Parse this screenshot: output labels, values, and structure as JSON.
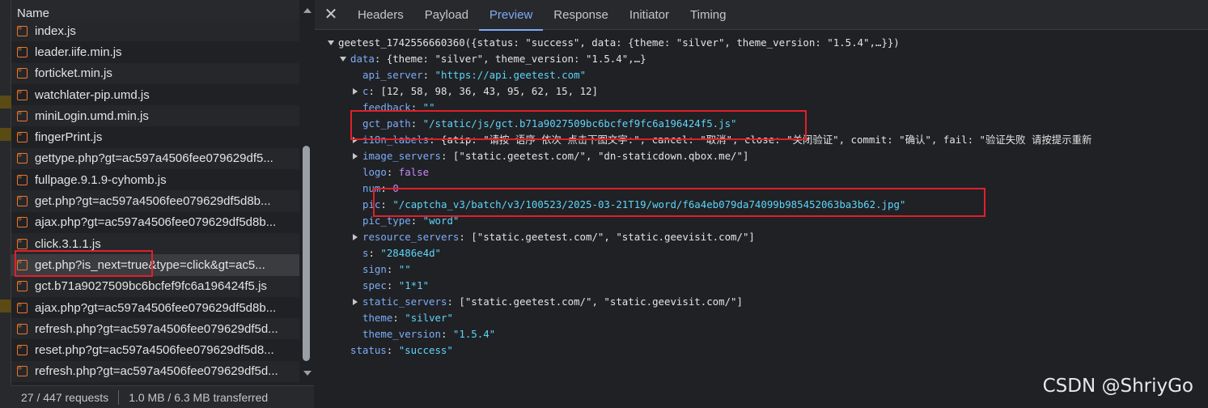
{
  "request_list": {
    "header": "Name",
    "items": [
      {
        "label": "index.js"
      },
      {
        "label": "leader.iife.min.js"
      },
      {
        "label": "forticket.min.js"
      },
      {
        "label": "watchlater-pip.umd.js"
      },
      {
        "label": "miniLogin.umd.min.js"
      },
      {
        "label": "fingerPrint.js"
      },
      {
        "label": "gettype.php?gt=ac597a4506fee079629df5..."
      },
      {
        "label": "fullpage.9.1.9-cyhomb.js"
      },
      {
        "label": "get.php?gt=ac597a4506fee079629df5d8b..."
      },
      {
        "label": "ajax.php?gt=ac597a4506fee079629df5d8b..."
      },
      {
        "label": "click.3.1.1.js"
      },
      {
        "label": "get.php?is_next=true&type=click&gt=ac5...",
        "selected": true
      },
      {
        "label": "gct.b71a9027509bc6bcfef9fc6a196424f5.js"
      },
      {
        "label": "ajax.php?gt=ac597a4506fee079629df5d8b..."
      },
      {
        "label": "refresh.php?gt=ac597a4506fee079629df5d..."
      },
      {
        "label": "reset.php?gt=ac597a4506fee079629df5d8..."
      },
      {
        "label": "refresh.php?gt=ac597a4506fee079629df5d..."
      }
    ]
  },
  "status_bar": {
    "requests": "27 / 447 requests",
    "transferred": "1.0 MB / 6.3 MB transferred"
  },
  "tabs": {
    "close": "✕",
    "items": [
      "Headers",
      "Payload",
      "Preview",
      "Response",
      "Initiator",
      "Timing"
    ],
    "active": "Preview"
  },
  "preview": {
    "root": "geetest_1742556660360({status: \"success\", data: {theme: \"silver\", theme_version: \"1.5.4\",…}})",
    "data_summary_key": "data",
    "data_summary": "{theme: \"silver\", theme_version: \"1.5.4\",…}",
    "api_server_key": "api_server",
    "api_server": "\"https://api.geetest.com\"",
    "c_key": "c",
    "c": "[12, 58, 98, 36, 43, 95, 62, 15, 12]",
    "feedback_key": "feedback",
    "feedback": "\"\"",
    "gct_path_key": "gct_path",
    "gct_path": "\"/static/js/gct.b71a9027509bc6bcfef9fc6a196424f5.js\"",
    "i18n_key": "i18n_labels",
    "i18n": "{atip: \"请按 语序 依次 点击下图文字:\", cancel: \"取消\", close: \"关闭验证\", commit: \"确认\", fail: \"验证失败 请按提示重新",
    "image_servers_key": "image_servers",
    "image_servers": "[\"static.geetest.com/\", \"dn-staticdown.qbox.me/\"]",
    "logo_key": "logo",
    "logo": "false",
    "num_key": "num",
    "num": "0",
    "pic_key": "pic",
    "pic": "\"/captcha_v3/batch/v3/100523/2025-03-21T19/word/f6a4eb079da74099b985452063ba3b62.jpg\"",
    "pic_type_key": "pic_type",
    "pic_type": "\"word\"",
    "resource_servers_key": "resource_servers",
    "resource_servers": "[\"static.geetest.com/\", \"static.geevisit.com/\"]",
    "s_key": "s",
    "s": "\"28486e4d\"",
    "sign_key": "sign",
    "sign": "\"\"",
    "spec_key": "spec",
    "spec": "\"1*1\"",
    "static_servers_key": "static_servers",
    "static_servers": "[\"static.geetest.com/\", \"static.geevisit.com/\"]",
    "theme_key": "theme",
    "theme": "\"silver\"",
    "theme_version_key": "theme_version",
    "theme_version": "\"1.5.4\"",
    "status_key": "status",
    "status": "\"success\""
  },
  "watermark": "CSDN @ShriyGo",
  "colors": {
    "background": "#202124",
    "key": "#7cacf8",
    "string": "#5cd5fb",
    "highlight_box": "#e0202a"
  }
}
